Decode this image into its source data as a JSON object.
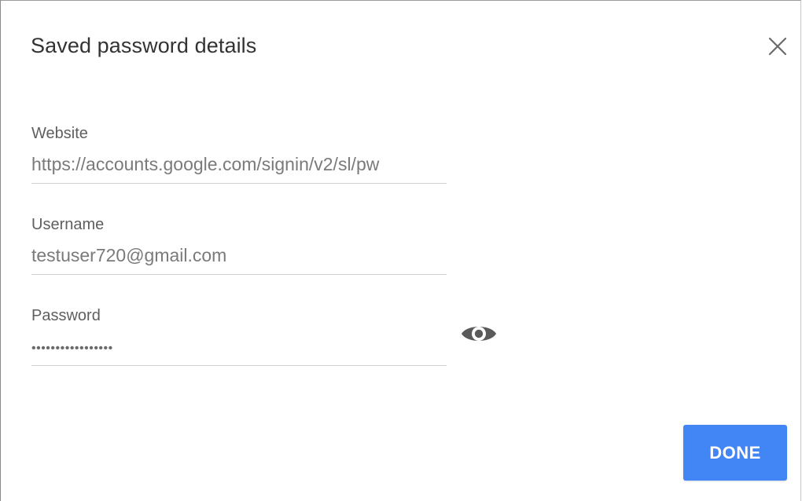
{
  "dialog": {
    "title": "Saved password details",
    "close_icon": "close-icon"
  },
  "fields": {
    "website": {
      "label": "Website",
      "value": "https://accounts.google.com/signin/v2/sl/pw"
    },
    "username": {
      "label": "Username",
      "value": "testuser720@gmail.com"
    },
    "password": {
      "label": "Password",
      "value": "•••••••••••••••••",
      "reveal_icon": "eye-icon"
    }
  },
  "actions": {
    "done_label": "DONE"
  },
  "colors": {
    "accent": "#4285f4",
    "label": "#5f5f5f",
    "value": "#7a7a7a",
    "divider": "#d3d3d3",
    "icon": "#5a5a5a"
  }
}
